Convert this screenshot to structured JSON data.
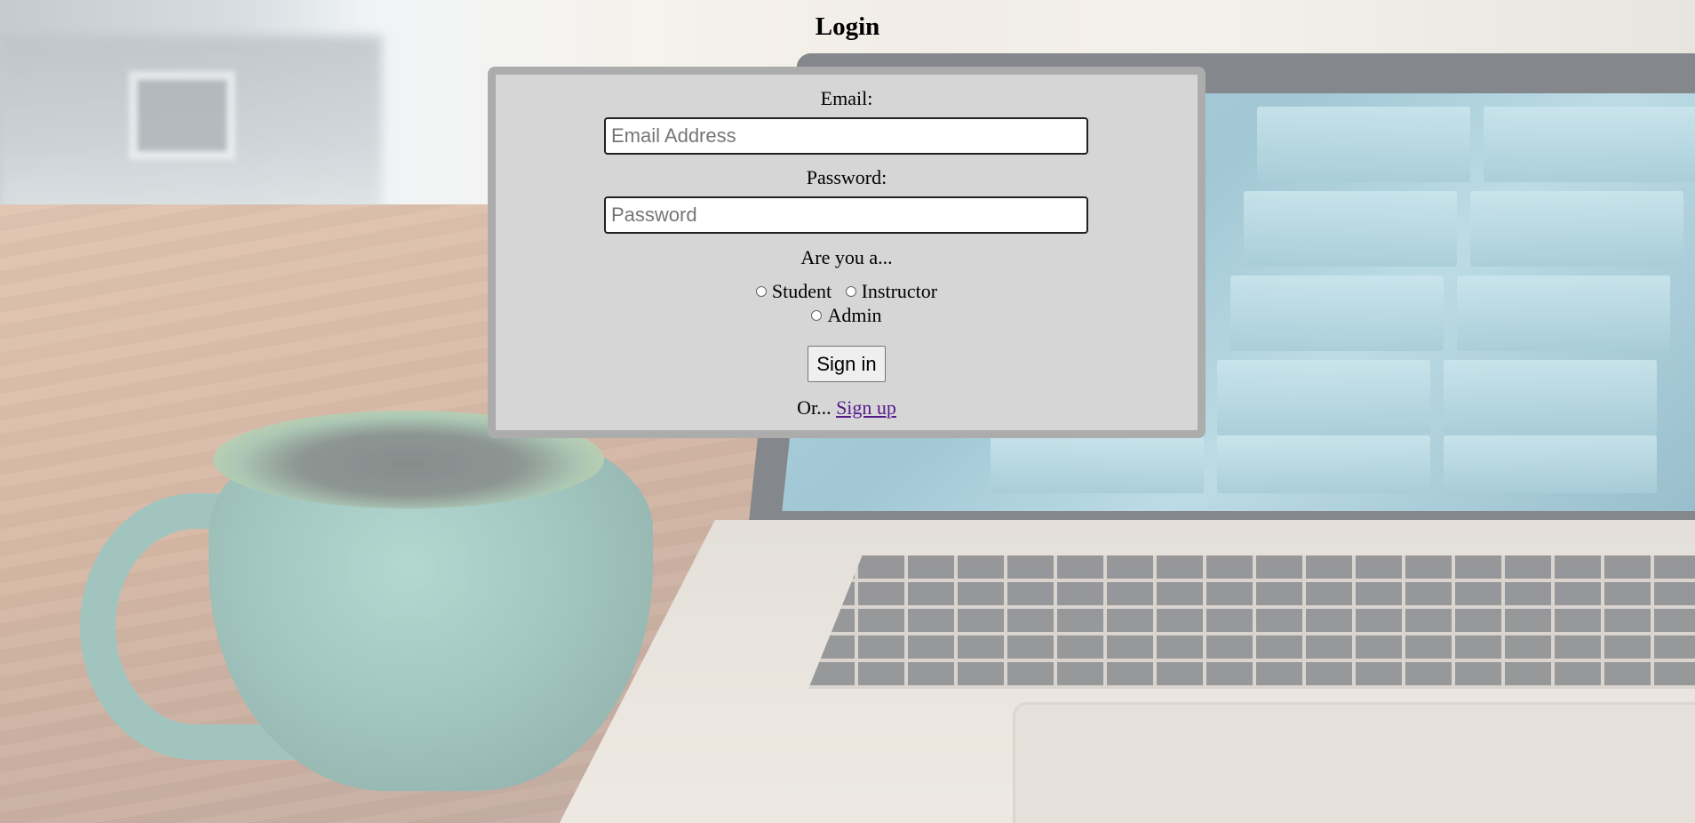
{
  "page": {
    "title": "Login"
  },
  "form": {
    "email_label": "Email:",
    "email_placeholder": "Email Address",
    "email_value": "",
    "password_label": "Password:",
    "password_placeholder": "Password",
    "password_value": "",
    "role_prompt": "Are you a...",
    "roles": [
      {
        "label": "Student",
        "checked": false
      },
      {
        "label": "Instructor",
        "checked": false
      },
      {
        "label": "Admin",
        "checked": false
      }
    ],
    "signin_label": "Sign in",
    "signup_prefix": "Or...",
    "signup_link": "Sign up"
  },
  "colors": {
    "card_background": "#d6d6d6",
    "card_border": "#acacac",
    "link_visited": "#551a8b"
  }
}
